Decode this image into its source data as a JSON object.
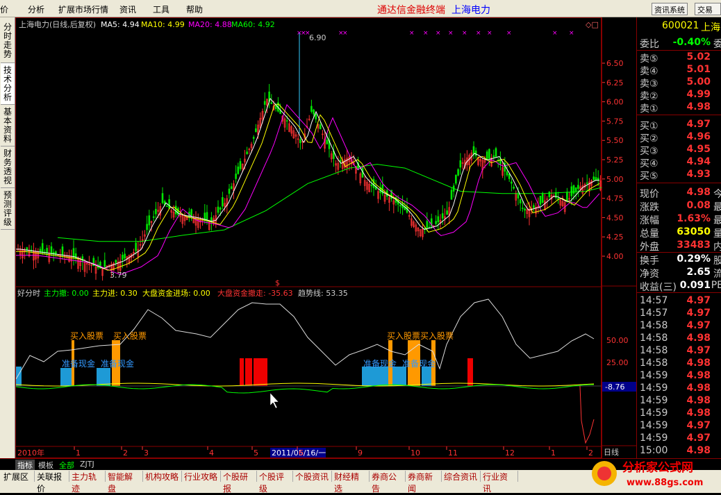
{
  "menu": {
    "items": [
      "价",
      "分析",
      "扩展市场行情",
      "资讯",
      "工具",
      "帮助"
    ],
    "brand": "通达信金融终端",
    "stock_name": "上海电力",
    "btn_news": "资讯系统",
    "btn_trade": "交易系"
  },
  "side_tabs": [
    "分时走势",
    "技术分析",
    "基本资料",
    "财务透视",
    "预测评级"
  ],
  "chart_header": {
    "title": "上海电力(日线,后复权)",
    "ma5": "MA5: 4.94",
    "ma10": "MA10: 4.99",
    "ma20": "MA20: 4.88",
    "ma60": "MA60: 4.92"
  },
  "price_labels": {
    "high": "6.90",
    "low": "3.79"
  },
  "ind_header": {
    "name": "好分时",
    "a": "主力撤: 0.00",
    "b": "主力进: 0.30",
    "c": "大盘资金进场: 0.00",
    "d": "大盘资金撤走: -35.63",
    "e": "趋势线: 53.35"
  },
  "signals": {
    "buy": "买入股票",
    "ready": "准备现金"
  },
  "price_axis": [
    "6.50",
    "6.25",
    "6.00",
    "5.75",
    "5.50",
    "5.25",
    "5.00",
    "4.75",
    "4.50",
    "4.25",
    "4.00"
  ],
  "ind_axis": [
    "50.00",
    "25.00"
  ],
  "ind_current": "-8.76",
  "date_axis": {
    "year": "2010年",
    "cursor": "2011/05/16/一",
    "months": [
      "1",
      "2",
      "3",
      "4",
      "5",
      "6",
      "9",
      "10",
      "11",
      "12",
      "1",
      "2"
    ],
    "period": "日线"
  },
  "quote": {
    "code": "600021",
    "name": "上海",
    "webi": {
      "label": "委比",
      "value": "-0.40%",
      "extra": "委"
    },
    "sells": [
      {
        "label": "卖⑤",
        "price": "5.02"
      },
      {
        "label": "卖④",
        "price": "5.01"
      },
      {
        "label": "卖③",
        "price": "5.00"
      },
      {
        "label": "卖②",
        "price": "4.99"
      },
      {
        "label": "卖①",
        "price": "4.98"
      }
    ],
    "buys": [
      {
        "label": "买①",
        "price": "4.97"
      },
      {
        "label": "买②",
        "price": "4.96"
      },
      {
        "label": "买③",
        "price": "4.95"
      },
      {
        "label": "买④",
        "price": "4.94"
      },
      {
        "label": "买⑤",
        "price": "4.93"
      }
    ],
    "stats": [
      {
        "label": "现价",
        "value": "4.98",
        "extra": "今"
      },
      {
        "label": "涨跌",
        "value": "0.08",
        "extra": "最"
      },
      {
        "label": "涨幅",
        "value": "1.63%",
        "extra": "最"
      },
      {
        "label": "总量",
        "value": "63050",
        "extra": "量"
      },
      {
        "label": "外盘",
        "value": "33483",
        "extra": "内"
      }
    ],
    "stats2": [
      {
        "label": "换手",
        "value": "0.29%",
        "extra": "股"
      },
      {
        "label": "净资",
        "value": "2.65",
        "extra": "流"
      },
      {
        "label": "收益(三)",
        "value": "0.091",
        "extra": "PE"
      }
    ],
    "ticks": [
      {
        "t": "14:57",
        "p": "4.97"
      },
      {
        "t": "14:57",
        "p": "4.97"
      },
      {
        "t": "14:58",
        "p": "4.97"
      },
      {
        "t": "14:58",
        "p": "4.98"
      },
      {
        "t": "14:58",
        "p": "4.97"
      },
      {
        "t": "14:58",
        "p": "4.98"
      },
      {
        "t": "14:59",
        "p": "4.98"
      },
      {
        "t": "14:59",
        "p": "4.98"
      },
      {
        "t": "14:59",
        "p": "4.98"
      },
      {
        "t": "14:59",
        "p": "4.98"
      },
      {
        "t": "14:59",
        "p": "4.97"
      },
      {
        "t": "14:59",
        "p": "4.97"
      },
      {
        "t": "15:00",
        "p": "4.98"
      }
    ]
  },
  "bottom_tabs": [
    "指标",
    "模板",
    "全部",
    "ZJTJ"
  ],
  "bottom_bar": [
    "扩展区",
    "关联报价",
    "主力轨迹",
    "智能解盘",
    "机构攻略",
    "行业攻略",
    "个股研报",
    "个股评级",
    "个股资讯",
    "财经精选",
    "券商公告",
    "券商新闻",
    "综合资讯",
    "行业资讯"
  ],
  "watermark": {
    "text": "分析家公式网",
    "url": "www.88gs.com"
  },
  "colors": {
    "up": "#ff3232",
    "down": "#00e600",
    "ma5": "#ffffff",
    "ma10": "#ffff00",
    "ma20": "#ff00ff",
    "ma60": "#00ff00",
    "border": "#800000"
  }
}
